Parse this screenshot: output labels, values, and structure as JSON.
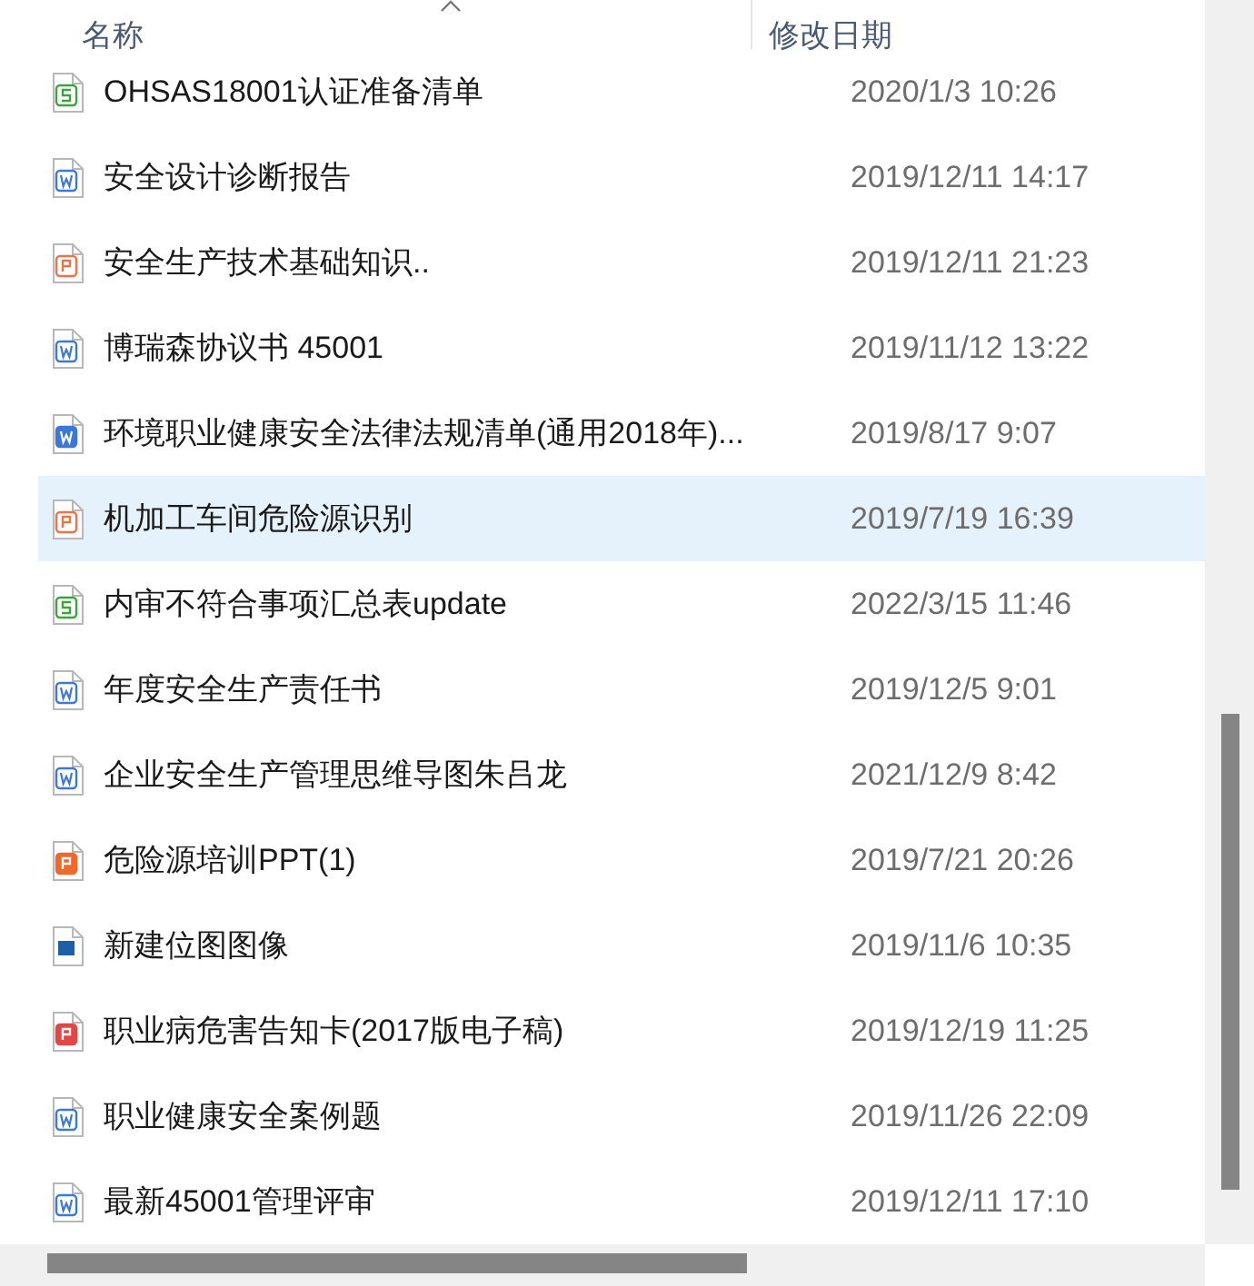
{
  "columns": [
    {
      "label": "名称",
      "sorted": true
    },
    {
      "label": "修改日期",
      "sorted": false
    }
  ],
  "files": [
    {
      "name": "OHSAS18001认证准备清单",
      "modified": "2020/1/3 10:26",
      "kind": "sheet",
      "selected": false
    },
    {
      "name": "安全设计诊断报告",
      "modified": "2019/12/11 14:17",
      "kind": "doc",
      "selected": false
    },
    {
      "name": "安全生产技术基础知识..",
      "modified": "2019/12/11 21:23",
      "kind": "ppt",
      "selected": false
    },
    {
      "name": "博瑞森协议书 45001",
      "modified": "2019/11/12 13:22",
      "kind": "doc",
      "selected": false
    },
    {
      "name": "环境职业健康安全法律法规清单(通用2018年)...",
      "modified": "2019/8/17 9:07",
      "kind": "doc-solid",
      "selected": false
    },
    {
      "name": "机加工车间危险源识别",
      "modified": "2019/7/19 16:39",
      "kind": "ppt",
      "selected": true
    },
    {
      "name": "内审不符合事项汇总表update",
      "modified": "2022/3/15 11:46",
      "kind": "sheet",
      "selected": false
    },
    {
      "name": "年度安全生产责任书",
      "modified": "2019/12/5 9:01",
      "kind": "doc",
      "selected": false
    },
    {
      "name": "企业安全生产管理思维导图朱吕龙",
      "modified": "2021/12/9 8:42",
      "kind": "doc",
      "selected": false
    },
    {
      "name": "危险源培训PPT(1)",
      "modified": "2019/7/21 20:26",
      "kind": "ppt-solid",
      "selected": false
    },
    {
      "name": "新建位图图像",
      "modified": "2019/11/6 10:35",
      "kind": "image",
      "selected": false
    },
    {
      "name": "职业病危害告知卡(2017版电子稿)",
      "modified": "2019/12/19 11:25",
      "kind": "pdf",
      "selected": false
    },
    {
      "name": "职业健康安全案例题",
      "modified": "2019/11/26 22:09",
      "kind": "doc",
      "selected": false
    },
    {
      "name": "最新45001管理评审",
      "modified": "2019/12/11 17:10",
      "kind": "doc",
      "selected": false
    }
  ]
}
